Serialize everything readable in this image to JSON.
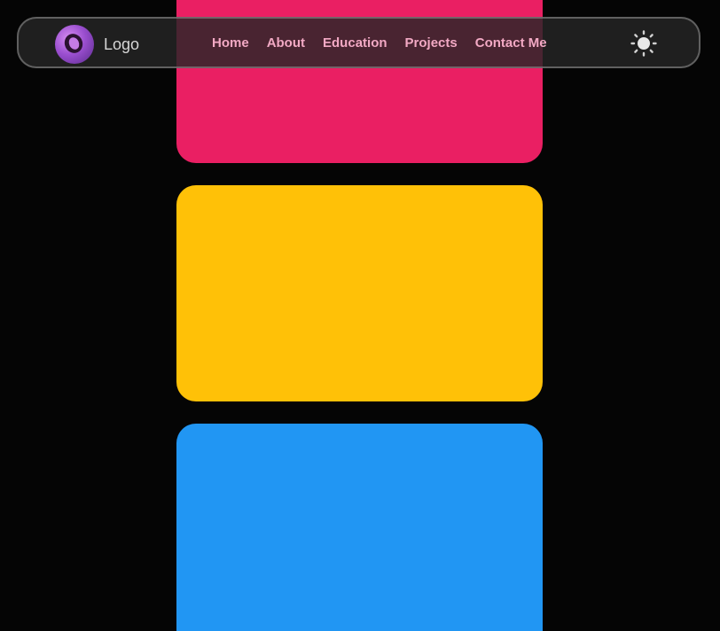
{
  "navbar": {
    "logo_text": "Logo",
    "links": [
      "Home",
      "About",
      "Education",
      "Projects",
      "Contact Me"
    ],
    "theme_icon": "sun-icon"
  },
  "cards": [
    {
      "name": "pink",
      "color": "#ea1f63"
    },
    {
      "name": "yellow",
      "color": "#ffc107"
    },
    {
      "name": "blue",
      "color": "#2196f3"
    }
  ],
  "colors": {
    "background": "#050505",
    "nav_link": "#f2a9c4",
    "logo_text": "#d6d6d6"
  }
}
